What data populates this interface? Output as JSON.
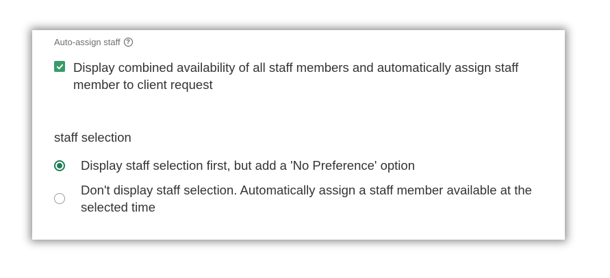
{
  "auto_assign": {
    "label": "Auto-assign staff",
    "help_icon": "help-circle-icon",
    "checkbox_checked": true,
    "checkbox_label": "Display combined availability of all staff members and automatically assign staff member to client request"
  },
  "staff_selection": {
    "title": "staff selection",
    "options": [
      {
        "label": "Display staff selection first, but add a 'No Preference' option",
        "selected": true
      },
      {
        "label": "Don't display staff selection. Automatically assign a staff member available at the selected time",
        "selected": false
      }
    ]
  },
  "colors": {
    "accent": "#1e7d57",
    "checkbox": "#3a9a6b",
    "text": "#333333",
    "muted": "#6e6e6e"
  }
}
